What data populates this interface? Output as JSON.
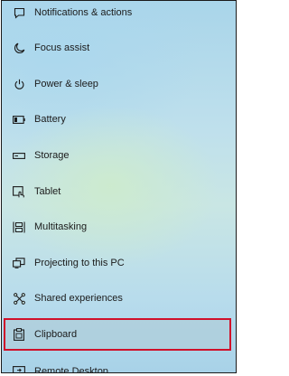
{
  "nav": {
    "items": [
      {
        "label": "Notifications & actions",
        "icon": "notifications-icon"
      },
      {
        "label": "Focus assist",
        "icon": "moon-icon"
      },
      {
        "label": "Power & sleep",
        "icon": "power-icon"
      },
      {
        "label": "Battery",
        "icon": "battery-icon"
      },
      {
        "label": "Storage",
        "icon": "storage-icon"
      },
      {
        "label": "Tablet",
        "icon": "tablet-icon"
      },
      {
        "label": "Multitasking",
        "icon": "multitasking-icon"
      },
      {
        "label": "Projecting to this PC",
        "icon": "projecting-icon"
      },
      {
        "label": "Shared experiences",
        "icon": "shared-experiences-icon"
      },
      {
        "label": "Clipboard",
        "icon": "clipboard-icon"
      },
      {
        "label": "Remote Desktop",
        "icon": "remote-desktop-icon"
      }
    ],
    "selected_index": 9
  },
  "colors": {
    "highlight_border": "#d0102a",
    "text": "#1b1b1b"
  }
}
